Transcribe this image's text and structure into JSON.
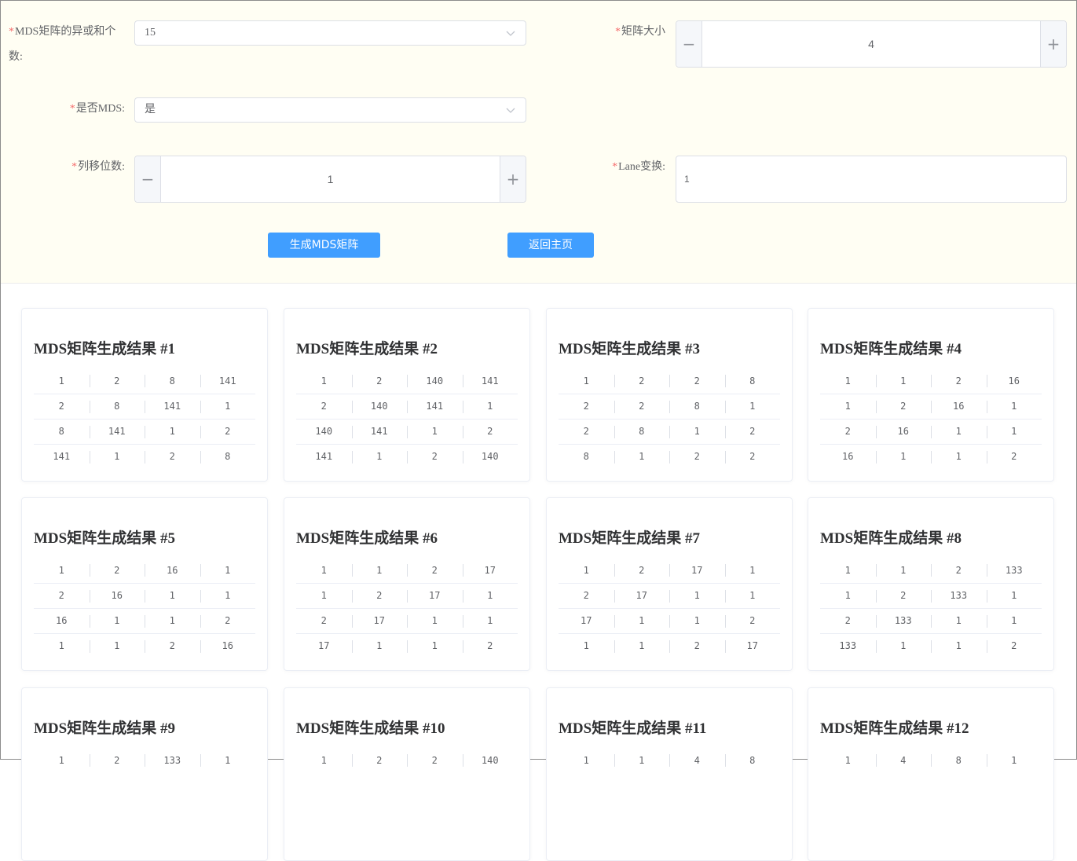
{
  "form": {
    "xor_count": {
      "label": "MDS矩阵的异或和个数:",
      "value": "15"
    },
    "matrix_size": {
      "label": "矩阵大小",
      "value": "4",
      "minus": "−",
      "plus": "+"
    },
    "is_mds": {
      "label": "是否MDS:",
      "value": "是"
    },
    "col_shift": {
      "label": "列移位数:",
      "value": "1",
      "minus": "−",
      "plus": "+"
    },
    "lane": {
      "label": "Lane变换:",
      "value": "1"
    },
    "required_mark": "*",
    "generate_button": "生成MDS矩阵",
    "home_button": "返回主页"
  },
  "results": [
    {
      "title": "MDS矩阵生成结果 #1",
      "rows": [
        [
          "1",
          "2",
          "8",
          "141"
        ],
        [
          "2",
          "8",
          "141",
          "1"
        ],
        [
          "8",
          "141",
          "1",
          "2"
        ],
        [
          "141",
          "1",
          "2",
          "8"
        ]
      ]
    },
    {
      "title": "MDS矩阵生成结果 #2",
      "rows": [
        [
          "1",
          "2",
          "140",
          "141"
        ],
        [
          "2",
          "140",
          "141",
          "1"
        ],
        [
          "140",
          "141",
          "1",
          "2"
        ],
        [
          "141",
          "1",
          "2",
          "140"
        ]
      ]
    },
    {
      "title": "MDS矩阵生成结果 #3",
      "rows": [
        [
          "1",
          "2",
          "2",
          "8"
        ],
        [
          "2",
          "2",
          "8",
          "1"
        ],
        [
          "2",
          "8",
          "1",
          "2"
        ],
        [
          "8",
          "1",
          "2",
          "2"
        ]
      ]
    },
    {
      "title": "MDS矩阵生成结果 #4",
      "rows": [
        [
          "1",
          "1",
          "2",
          "16"
        ],
        [
          "1",
          "2",
          "16",
          "1"
        ],
        [
          "2",
          "16",
          "1",
          "1"
        ],
        [
          "16",
          "1",
          "1",
          "2"
        ]
      ]
    },
    {
      "title": "MDS矩阵生成结果 #5",
      "rows": [
        [
          "1",
          "2",
          "16",
          "1"
        ],
        [
          "2",
          "16",
          "1",
          "1"
        ],
        [
          "16",
          "1",
          "1",
          "2"
        ],
        [
          "1",
          "1",
          "2",
          "16"
        ]
      ]
    },
    {
      "title": "MDS矩阵生成结果 #6",
      "rows": [
        [
          "1",
          "1",
          "2",
          "17"
        ],
        [
          "1",
          "2",
          "17",
          "1"
        ],
        [
          "2",
          "17",
          "1",
          "1"
        ],
        [
          "17",
          "1",
          "1",
          "2"
        ]
      ]
    },
    {
      "title": "MDS矩阵生成结果 #7",
      "rows": [
        [
          "1",
          "2",
          "17",
          "1"
        ],
        [
          "2",
          "17",
          "1",
          "1"
        ],
        [
          "17",
          "1",
          "1",
          "2"
        ],
        [
          "1",
          "1",
          "2",
          "17"
        ]
      ]
    },
    {
      "title": "MDS矩阵生成结果 #8",
      "rows": [
        [
          "1",
          "1",
          "2",
          "133"
        ],
        [
          "1",
          "2",
          "133",
          "1"
        ],
        [
          "2",
          "133",
          "1",
          "1"
        ],
        [
          "133",
          "1",
          "1",
          "2"
        ]
      ]
    },
    {
      "title": "MDS矩阵生成结果 #9",
      "rows": [
        [
          "1",
          "2",
          "133",
          "1"
        ]
      ]
    },
    {
      "title": "MDS矩阵生成结果 #10",
      "rows": [
        [
          "1",
          "2",
          "2",
          "140"
        ]
      ]
    },
    {
      "title": "MDS矩阵生成结果 #11",
      "rows": [
        [
          "1",
          "1",
          "4",
          "8"
        ]
      ]
    },
    {
      "title": "MDS矩阵生成结果 #12",
      "rows": [
        [
          "1",
          "4",
          "8",
          "1"
        ]
      ]
    }
  ]
}
